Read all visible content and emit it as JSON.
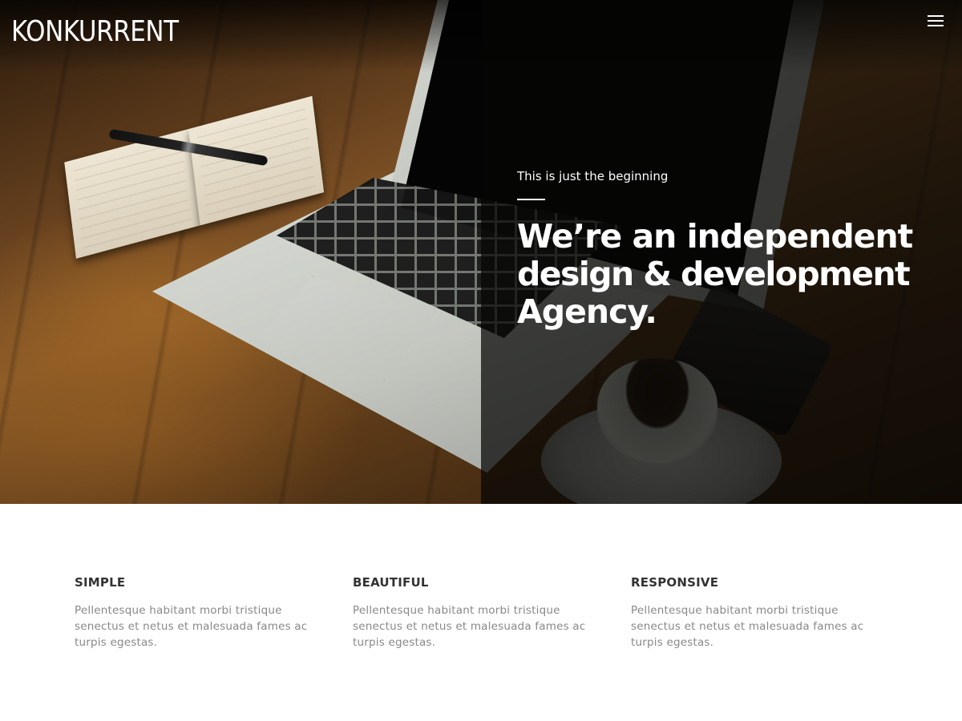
{
  "header": {
    "logo": "KONKURRENT",
    "menu_icon": "hamburger-icon"
  },
  "hero": {
    "eyebrow": "This is just the beginning",
    "headline": {
      "line1": "We’re an independent",
      "line2": "design & development",
      "line3": "Agency."
    }
  },
  "features": [
    {
      "title": "SIMPLE",
      "text": "Pellentesque habitant morbi tristique senectus et netus et malesuada fames ac turpis egestas."
    },
    {
      "title": "BEAUTIFUL",
      "text": "Pellentesque habitant morbi tristique senectus et netus et malesuada fames ac turpis egestas."
    },
    {
      "title": "RESPONSIVE",
      "text": "Pellentesque habitant morbi tristique senectus et netus et malesuada fames ac turpis egestas."
    }
  ],
  "colors": {
    "hero_overlay": "#060604",
    "text_light": "#ffffff",
    "feature_title": "#333333",
    "feature_text": "#888888"
  }
}
